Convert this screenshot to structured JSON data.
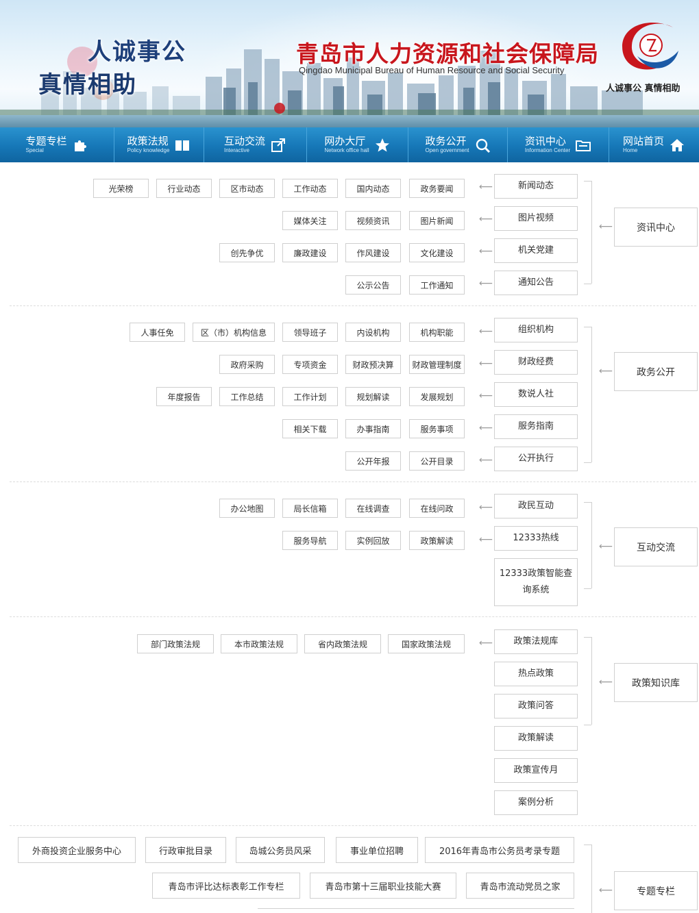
{
  "header": {
    "slogan_line1": "人诚事公",
    "slogan_line2": "真情相助",
    "bureau_cn": "青岛市人力资源和社会保障局",
    "bureau_en": "Qingdao Municipal Bureau of Human Resource and Social Security",
    "logo_caption": "人诚事公 真情相助",
    "brand_red": "#c8161d",
    "brand_blue": "#1677b7"
  },
  "nav": [
    {
      "cn": "网站首页",
      "en": "Home",
      "icon": "home-icon"
    },
    {
      "cn": "资讯中心",
      "en": "Information Center",
      "icon": "folder-icon"
    },
    {
      "cn": "政务公开",
      "en": "Open government",
      "icon": "search-icon"
    },
    {
      "cn": "网办大厅",
      "en": "Network office hall",
      "icon": "star-icon"
    },
    {
      "cn": "互动交流",
      "en": "Interactive",
      "icon": "share-icon"
    },
    {
      "cn": "政策法规",
      "en": "Policy knowledge",
      "icon": "book-icon"
    },
    {
      "cn": "专题专栏",
      "en": "Special",
      "icon": "puzzle-icon"
    }
  ],
  "sitemap": [
    {
      "title": "资讯中心",
      "subs": [
        {
          "label": "新闻动态",
          "items": [
            "政务要闻",
            "国内动态",
            "工作动态",
            "区市动态",
            "行业动态",
            "光荣榜"
          ]
        },
        {
          "label": "图片视频",
          "items": [
            "图片新闻",
            "视频资讯",
            "媒体关注"
          ]
        },
        {
          "label": "机关党建",
          "items": [
            "文化建设",
            "作风建设",
            "廉政建设",
            "创先争优"
          ]
        },
        {
          "label": "通知公告",
          "items": [
            "工作通知",
            "公示公告"
          ]
        }
      ]
    },
    {
      "title": "政务公开",
      "subs": [
        {
          "label": "组织机构",
          "items": [
            "机构职能",
            "内设机构",
            "领导班子",
            "区（市）机构信息",
            "人事任免"
          ]
        },
        {
          "label": "财政经费",
          "items": [
            "财政管理制度",
            "财政预决算",
            "专项资金",
            "政府采购"
          ]
        },
        {
          "label": "数说人社",
          "items": [
            "发展规划",
            "规划解读",
            "工作计划",
            "工作总结",
            "年度报告"
          ]
        },
        {
          "label": "服务指南",
          "items": [
            "服务事项",
            "办事指南",
            "相关下载"
          ]
        },
        {
          "label": "公开执行",
          "items": [
            "公开目录",
            "公开年报"
          ]
        }
      ]
    },
    {
      "title": "互动交流",
      "subs": [
        {
          "label": "政民互动",
          "items": [
            "在线问政",
            "在线调查",
            "局长信箱",
            "办公地图"
          ]
        },
        {
          "label": "12333热线",
          "items": [
            "政策解读",
            "实例回放",
            "服务导航"
          ]
        },
        {
          "label": "12333政策智能查询系统",
          "items": []
        }
      ]
    },
    {
      "title": "政策知识库",
      "subs": [
        {
          "label": "政策法规库",
          "items": [
            "国家政策法规",
            "省内政策法规",
            "本市政策法规",
            "部门政策法规"
          ]
        },
        {
          "label": "热点政策",
          "items": []
        },
        {
          "label": "政策问答",
          "items": []
        },
        {
          "label": "政策解读",
          "items": []
        },
        {
          "label": "政策宣传月",
          "items": []
        },
        {
          "label": "案例分析",
          "items": []
        }
      ]
    },
    {
      "title": "专题专栏",
      "rows": [
        [
          "2016年青岛市公务员考录专题",
          "事业单位招聘",
          "岛城公务员风采",
          "行政审批目录",
          "外商投资企业服务中心"
        ],
        [
          "青岛市流动党员之家",
          "青岛市第十三届职业技能大赛",
          "青岛市评比达标表彰工作专栏"
        ]
      ]
    }
  ]
}
